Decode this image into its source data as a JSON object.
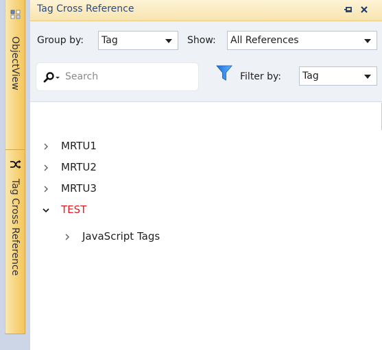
{
  "sidebar": {
    "tabs": [
      {
        "label": "ObjectView"
      },
      {
        "label": "Tag Cross Reference"
      }
    ]
  },
  "panel": {
    "title": "Tag Cross Reference",
    "pin_label": "⭹",
    "close_label": "✕"
  },
  "toolbar": {
    "group_by_label": "Group by:",
    "group_by_value": "Tag",
    "show_label": "Show:",
    "show_value": "All References",
    "search_placeholder": "Search",
    "filter_by_label": "Filter by:",
    "filter_by_value": "Tag"
  },
  "tree": {
    "items": [
      {
        "label": "MRTU1",
        "expanded": false
      },
      {
        "label": "MRTU2",
        "expanded": false
      },
      {
        "label": "MRTU3",
        "expanded": false
      },
      {
        "label": "TEST",
        "expanded": true,
        "color": "#e31b23"
      },
      {
        "label": "JavaScript Tags",
        "expanded": false
      }
    ]
  }
}
